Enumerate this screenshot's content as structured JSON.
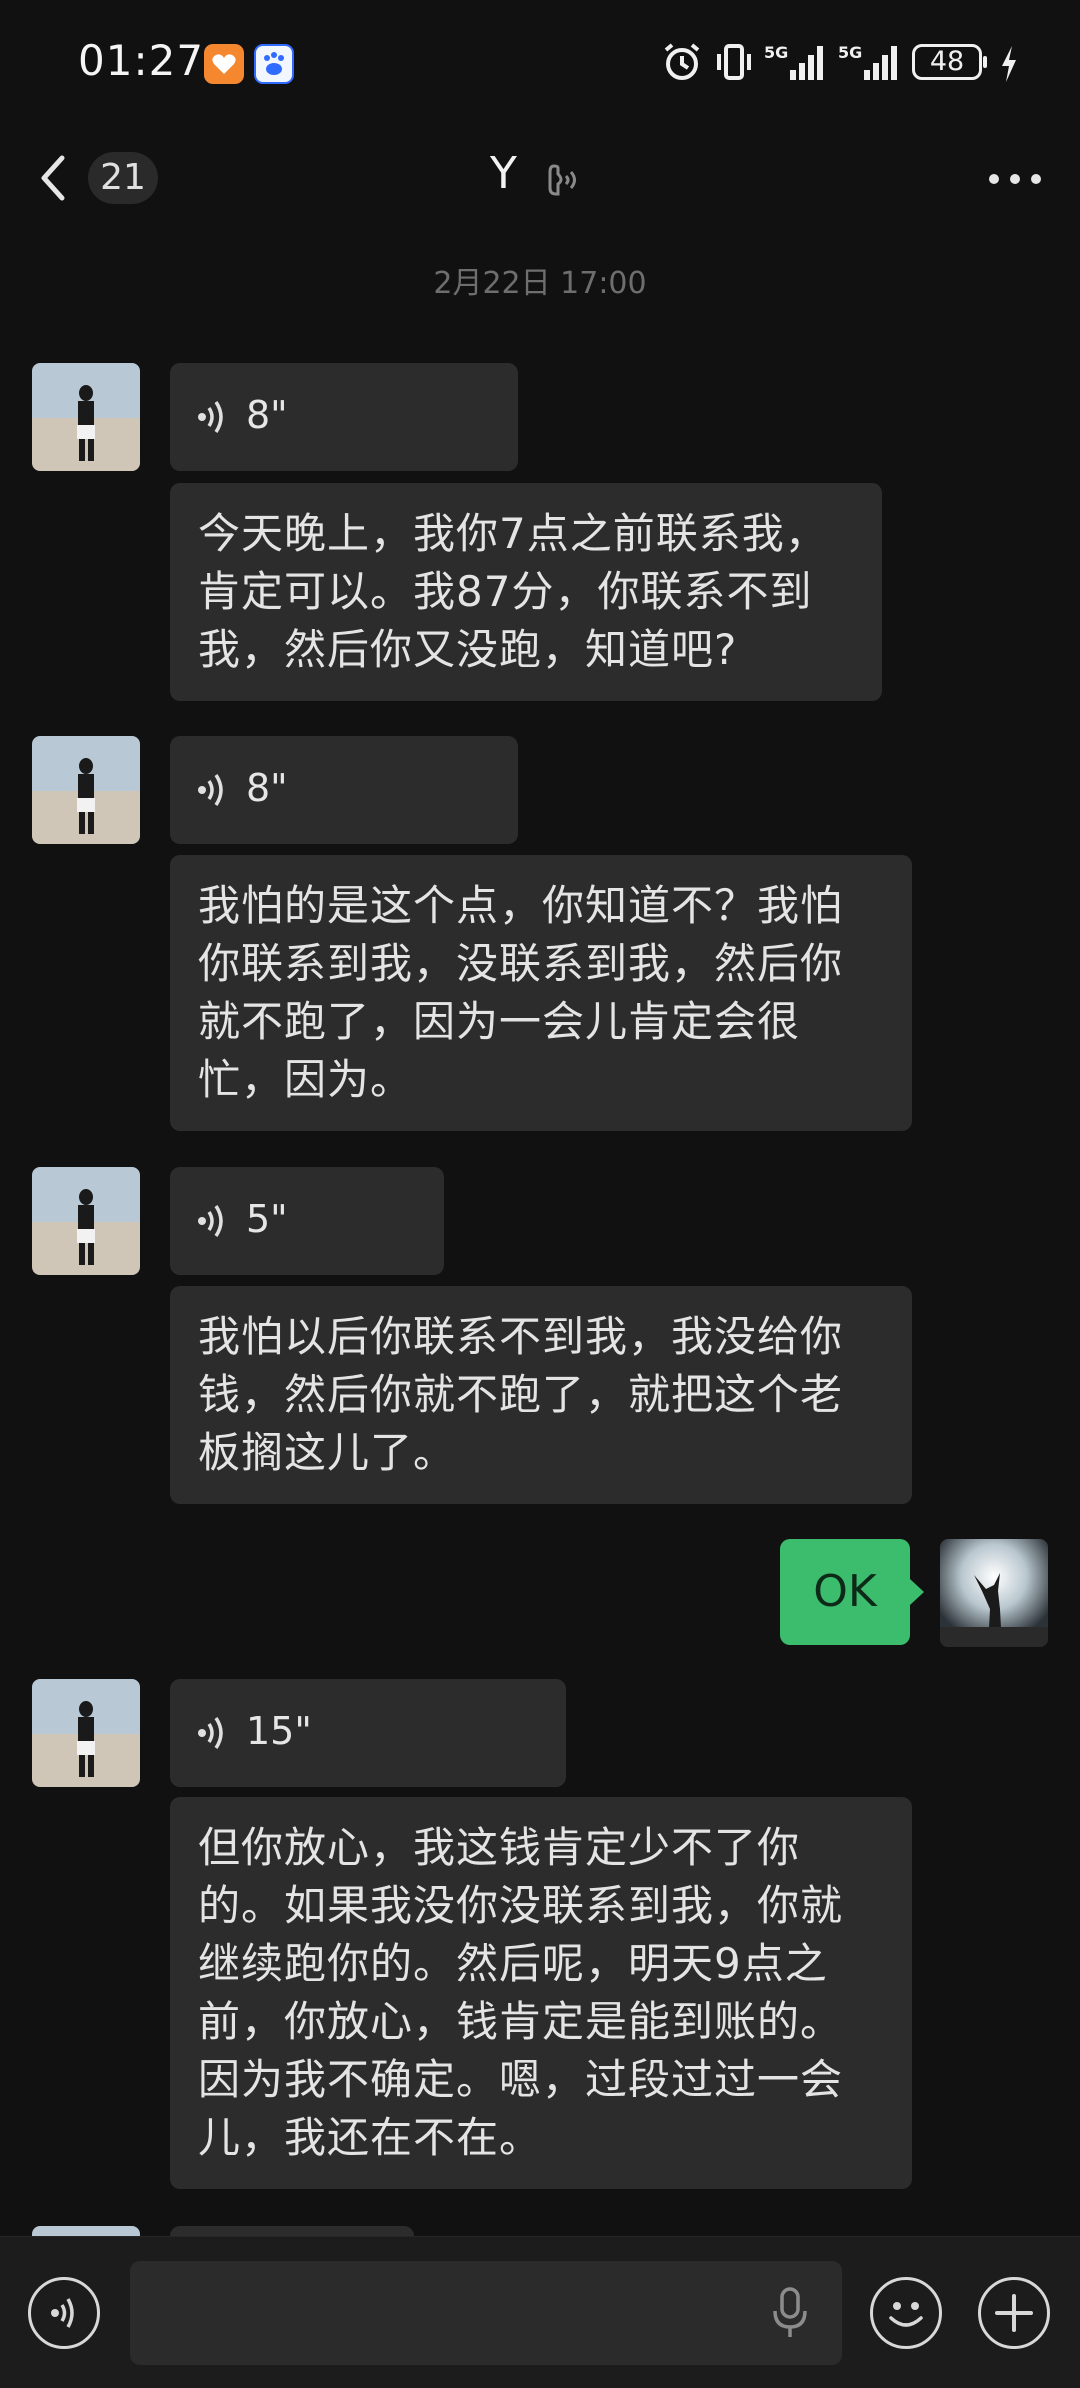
{
  "status_bar": {
    "time": "01:27",
    "battery": "48",
    "network_1": "5G",
    "network_2": "5G"
  },
  "header": {
    "unread_count": "21",
    "title": "Y"
  },
  "timestamp": "2月22日 17:00",
  "messages": [
    {
      "type": "voice",
      "duration": "8\""
    },
    {
      "type": "text",
      "text": "今天晚上，我你7点之前联系我，肯定可以。我87分，你联系不到我，然后你又没跑，知道吧?"
    },
    {
      "type": "voice",
      "duration": "8\""
    },
    {
      "type": "text",
      "text": "我怕的是这个点，你知道不？我怕你联系到我，没联系到我，然后你就不跑了，因为一会儿肯定会很忙，因为。"
    },
    {
      "type": "voice",
      "duration": "5\""
    },
    {
      "type": "text",
      "text": "我怕以后你联系不到我，我没给你钱，然后你就不跑了，就把这个老板搁这儿了。"
    },
    {
      "type": "sent",
      "text": "OK"
    },
    {
      "type": "voice",
      "duration": "15\""
    },
    {
      "type": "text",
      "text": "但你放心，我这钱肯定少不了你的。如果我没你没联系到我，你就继续跑你的。然后呢，明天9点之前，你放心，钱肯定是能到账的。因为我不确定。嗯，过段过过一会儿，我还在不在。"
    }
  ],
  "input": {
    "value": "",
    "placeholder": ""
  },
  "colors": {
    "background": "#111111",
    "bubble": "#2c2c2c",
    "sent_bubble": "#3cbd6e"
  }
}
